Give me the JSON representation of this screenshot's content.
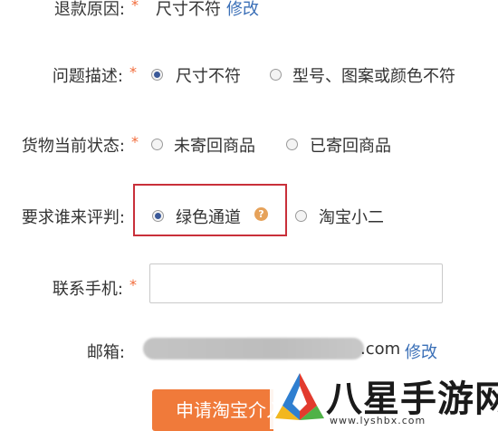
{
  "form": {
    "refund_reason": {
      "label": "退款原因:",
      "required_mark": "*",
      "value": "尺寸不符",
      "edit_link": "修改"
    },
    "problem_description": {
      "label": "问题描述:",
      "required_mark": "*",
      "options": [
        "尺寸不符",
        "型号、图案或颜色不符"
      ],
      "selected": "尺寸不符"
    },
    "goods_status": {
      "label": "货物当前状态:",
      "required_mark": "*",
      "options": [
        "未寄回商品",
        "已寄回商品"
      ],
      "selected": null
    },
    "arbitrator": {
      "label": "要求谁来评判:",
      "options": [
        "绿色通道",
        "淘宝小二"
      ],
      "selected": "绿色通道",
      "help_glyph": "?"
    },
    "contact_phone": {
      "label": "联系手机:",
      "required_mark": "*",
      "value": "",
      "placeholder": ""
    },
    "email": {
      "label": "邮箱:",
      "domain_suffix": ".com",
      "edit_link": "修改"
    },
    "submit_button": {
      "label": "申请淘宝介入"
    }
  },
  "watermark": {
    "site_name": "八星手游网",
    "site_url": "www.lyshbx.com"
  },
  "colors": {
    "required_star": "#f26b3a",
    "link": "#3a6fb7",
    "highlight_box": "#c9303a",
    "submit_button": "#f07a3a",
    "help_icon": "#e6a25a"
  }
}
